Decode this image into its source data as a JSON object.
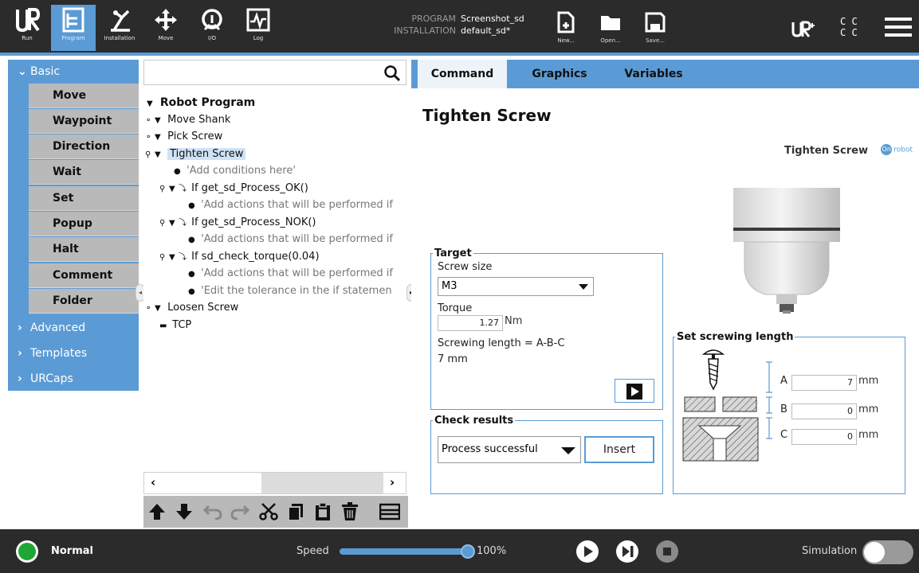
{
  "header": {
    "nav_buttons": [
      {
        "label": "Run",
        "icon": "ur-logo-icon"
      },
      {
        "label": "Program",
        "icon": "program-icon"
      },
      {
        "label": "Installation",
        "icon": "installation-icon"
      },
      {
        "label": "Move",
        "icon": "move-icon"
      },
      {
        "label": "I/O",
        "icon": "io-icon"
      },
      {
        "label": "Log",
        "icon": "log-icon"
      }
    ],
    "program_key": "PROGRAM",
    "program_value": "Screenshot_sd",
    "installation_key": "INSTALLATION",
    "installation_value": "default_sd*",
    "file_buttons": [
      {
        "label": "New...",
        "icon": "new-file-icon"
      },
      {
        "label": "Open...",
        "icon": "open-folder-icon"
      },
      {
        "label": "Save...",
        "icon": "save-icon"
      }
    ],
    "cc_text": "C C C C",
    "accent": "#5b9bd5"
  },
  "leftnav": {
    "basic_label": "Basic",
    "basic_items": [
      "Move",
      "Waypoint",
      "Direction",
      "Wait",
      "Set",
      "Popup",
      "Halt",
      "Comment",
      "Folder"
    ],
    "advanced_label": "Advanced",
    "templates_label": "Templates",
    "urcaps_label": "URCaps"
  },
  "tree": {
    "search_placeholder": "",
    "rows": [
      {
        "text": "Robot Program",
        "type": "root"
      },
      {
        "text": "Move Shank",
        "type": "node"
      },
      {
        "text": "Pick Screw",
        "type": "node"
      },
      {
        "text": "Tighten Screw",
        "type": "node-selected"
      },
      {
        "text": "'Add conditions here'",
        "type": "comment"
      },
      {
        "text": "If get_sd_Process_OK()",
        "type": "if"
      },
      {
        "text": "'Add actions that will be performed if",
        "type": "comment"
      },
      {
        "text": "If get_sd_Process_NOK()",
        "type": "if"
      },
      {
        "text": "'Add actions that will be performed if",
        "type": "comment"
      },
      {
        "text": "If sd_check_torque(0.04)",
        "type": "if"
      },
      {
        "text": "'Add actions that will be performed if",
        "type": "comment"
      },
      {
        "text": "'Edit the tolerance in the if statemen",
        "type": "comment"
      },
      {
        "text": "Loosen Screw",
        "type": "node"
      },
      {
        "text": "TCP",
        "type": "tcp"
      }
    ]
  },
  "tabs": [
    "Command",
    "Graphics",
    "Variables"
  ],
  "command": {
    "title": "Tighten Screw",
    "urcap_label": "Tighten Screw",
    "brand": "robot",
    "target_legend": "Target",
    "screw_size_label": "Screw size",
    "screw_size_value": "M3",
    "torque_label": "Torque",
    "torque_value": "1.27",
    "torque_unit": "Nm",
    "screwing_formula": "Screwing length = A-B-C",
    "screwing_value": "7 mm",
    "check_legend": "Check results",
    "check_value": "Process successful",
    "insert_label": "Insert",
    "screw_legend": "Set screwing length",
    "a_label": "A",
    "a_value": "7",
    "b_label": "B",
    "b_value": "0",
    "c_label": "C",
    "c_value": "0",
    "mm": "mm"
  },
  "footer": {
    "status": "Normal",
    "status_color": "#1fa635",
    "speed_label": "Speed",
    "speed_value": "100%",
    "speed_fraction": 1.0,
    "simulation_label": "Simulation",
    "simulation_on": false
  }
}
